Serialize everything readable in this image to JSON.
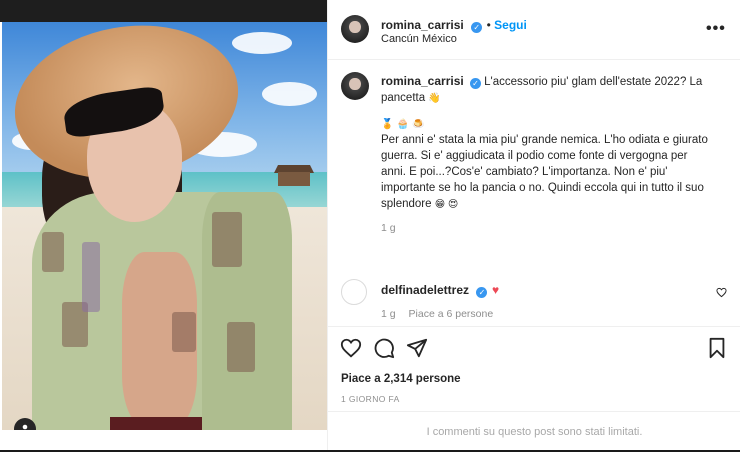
{
  "post": {
    "author": "romina_carrisi",
    "follow_label": "Segui",
    "location": "Cancún México",
    "more_label": "•••",
    "verified_mark": "✓"
  },
  "caption": {
    "author": "romina_carrisi",
    "line1": "L'accessorio piu' glam dell'estate 2022? La",
    "line2": "pancetta",
    "emoji_line_1": "🏅",
    "emoji_line_2": "🧁",
    "emoji_line_3": "🍮",
    "body1": "Per anni e' stata la mia piu' grande nemica. L'ho odiata e giurato",
    "body2": "guerra. Si e' aggiudicata il podio come fonte di vergogna per",
    "body3": "anni. E poi...?Cos'e' cambiato? L'importanza. Non e' piu'",
    "body4": "importante se ho la pancia o no. Quindi eccola qui in tutto il suo",
    "body5": "splendore",
    "end_emojis": "😁 😍",
    "hand_emoji": "👋",
    "time": "1 g"
  },
  "comment": {
    "author": "delfinadelettrez",
    "heart": "♥",
    "time": "1 g",
    "likes": "Piace a 6 persone"
  },
  "actions": {
    "likes": "Piace a 2,314 persone",
    "date": "1 GIORNO FA",
    "limited": "I commenti su questo post sono stati limitati."
  },
  "icons": [
    "heart-icon",
    "comment-icon",
    "share-icon",
    "bookmark-icon",
    "user-tag-icon",
    "small-heart-icon",
    "more-options-icon"
  ],
  "colors": {
    "accent": "#0095f6",
    "verified": "#3897f0",
    "like_red": "#ed4956",
    "muted": "#8e8e8e"
  }
}
